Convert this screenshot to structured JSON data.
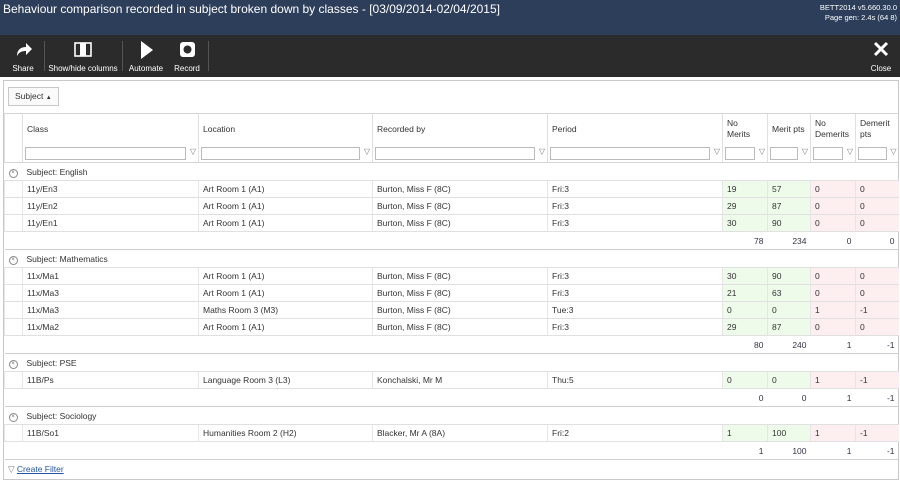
{
  "window": {
    "title": "Behaviour comparison recorded in subject broken down by classes - [03/09/2014-02/04/2015]",
    "version": "BETT2014 v5.660.30.0",
    "page_gen": "Page gen: 2.4s (64 8)"
  },
  "toolbar": {
    "share": "Share",
    "show_hide": "Show/hide columns",
    "automate": "Automate",
    "record": "Record",
    "close": "Close"
  },
  "group_chip": "Subject",
  "columns": [
    "Class",
    "Location",
    "Recorded by",
    "Period",
    "No Merits",
    "Merit pts",
    "No Demerits",
    "Demerit pts"
  ],
  "groups": [
    {
      "label": "Subject: English",
      "rows": [
        [
          "11y/En3",
          "Art Room 1 (A1)",
          "Burton, Miss F (8C)",
          "Fri:3",
          "19",
          "57",
          "0",
          "0"
        ],
        [
          "11y/En2",
          "Art Room 1 (A1)",
          "Burton, Miss F (8C)",
          "Fri:3",
          "29",
          "87",
          "0",
          "0"
        ],
        [
          "11y/En1",
          "Art Room 1 (A1)",
          "Burton, Miss F (8C)",
          "Fri:3",
          "30",
          "90",
          "0",
          "0"
        ]
      ],
      "totals": [
        "78",
        "234",
        "0",
        "0"
      ]
    },
    {
      "label": "Subject: Mathematics",
      "rows": [
        [
          "11x/Ma1",
          "Art Room 1 (A1)",
          "Burton, Miss F (8C)",
          "Fri:3",
          "30",
          "90",
          "0",
          "0"
        ],
        [
          "11x/Ma3",
          "Art Room 1 (A1)",
          "Burton, Miss F (8C)",
          "Fri:3",
          "21",
          "63",
          "0",
          "0"
        ],
        [
          "11x/Ma3",
          "Maths Room 3 (M3)",
          "Burton, Miss F (8C)",
          "Tue:3",
          "0",
          "0",
          "1",
          "-1"
        ],
        [
          "11x/Ma2",
          "Art Room 1 (A1)",
          "Burton, Miss F (8C)",
          "Fri:3",
          "29",
          "87",
          "0",
          "0"
        ]
      ],
      "totals": [
        "80",
        "240",
        "1",
        "-1"
      ]
    },
    {
      "label": "Subject: PSE",
      "rows": [
        [
          "11B/Ps",
          "Language Room 3 (L3)",
          "Konchalski, Mr M",
          "Thu:5",
          "0",
          "0",
          "1",
          "-1"
        ]
      ],
      "totals": [
        "0",
        "0",
        "1",
        "-1"
      ]
    },
    {
      "label": "Subject: Sociology",
      "rows": [
        [
          "11B/So1",
          "Humanities Room 2 (H2)",
          "Blacker, Mr A (8A)",
          "Fri:2",
          "1",
          "100",
          "1",
          "-1"
        ]
      ],
      "totals": [
        "1",
        "100",
        "1",
        "-1"
      ]
    }
  ],
  "footer": {
    "create_filter": "Create Filter"
  }
}
